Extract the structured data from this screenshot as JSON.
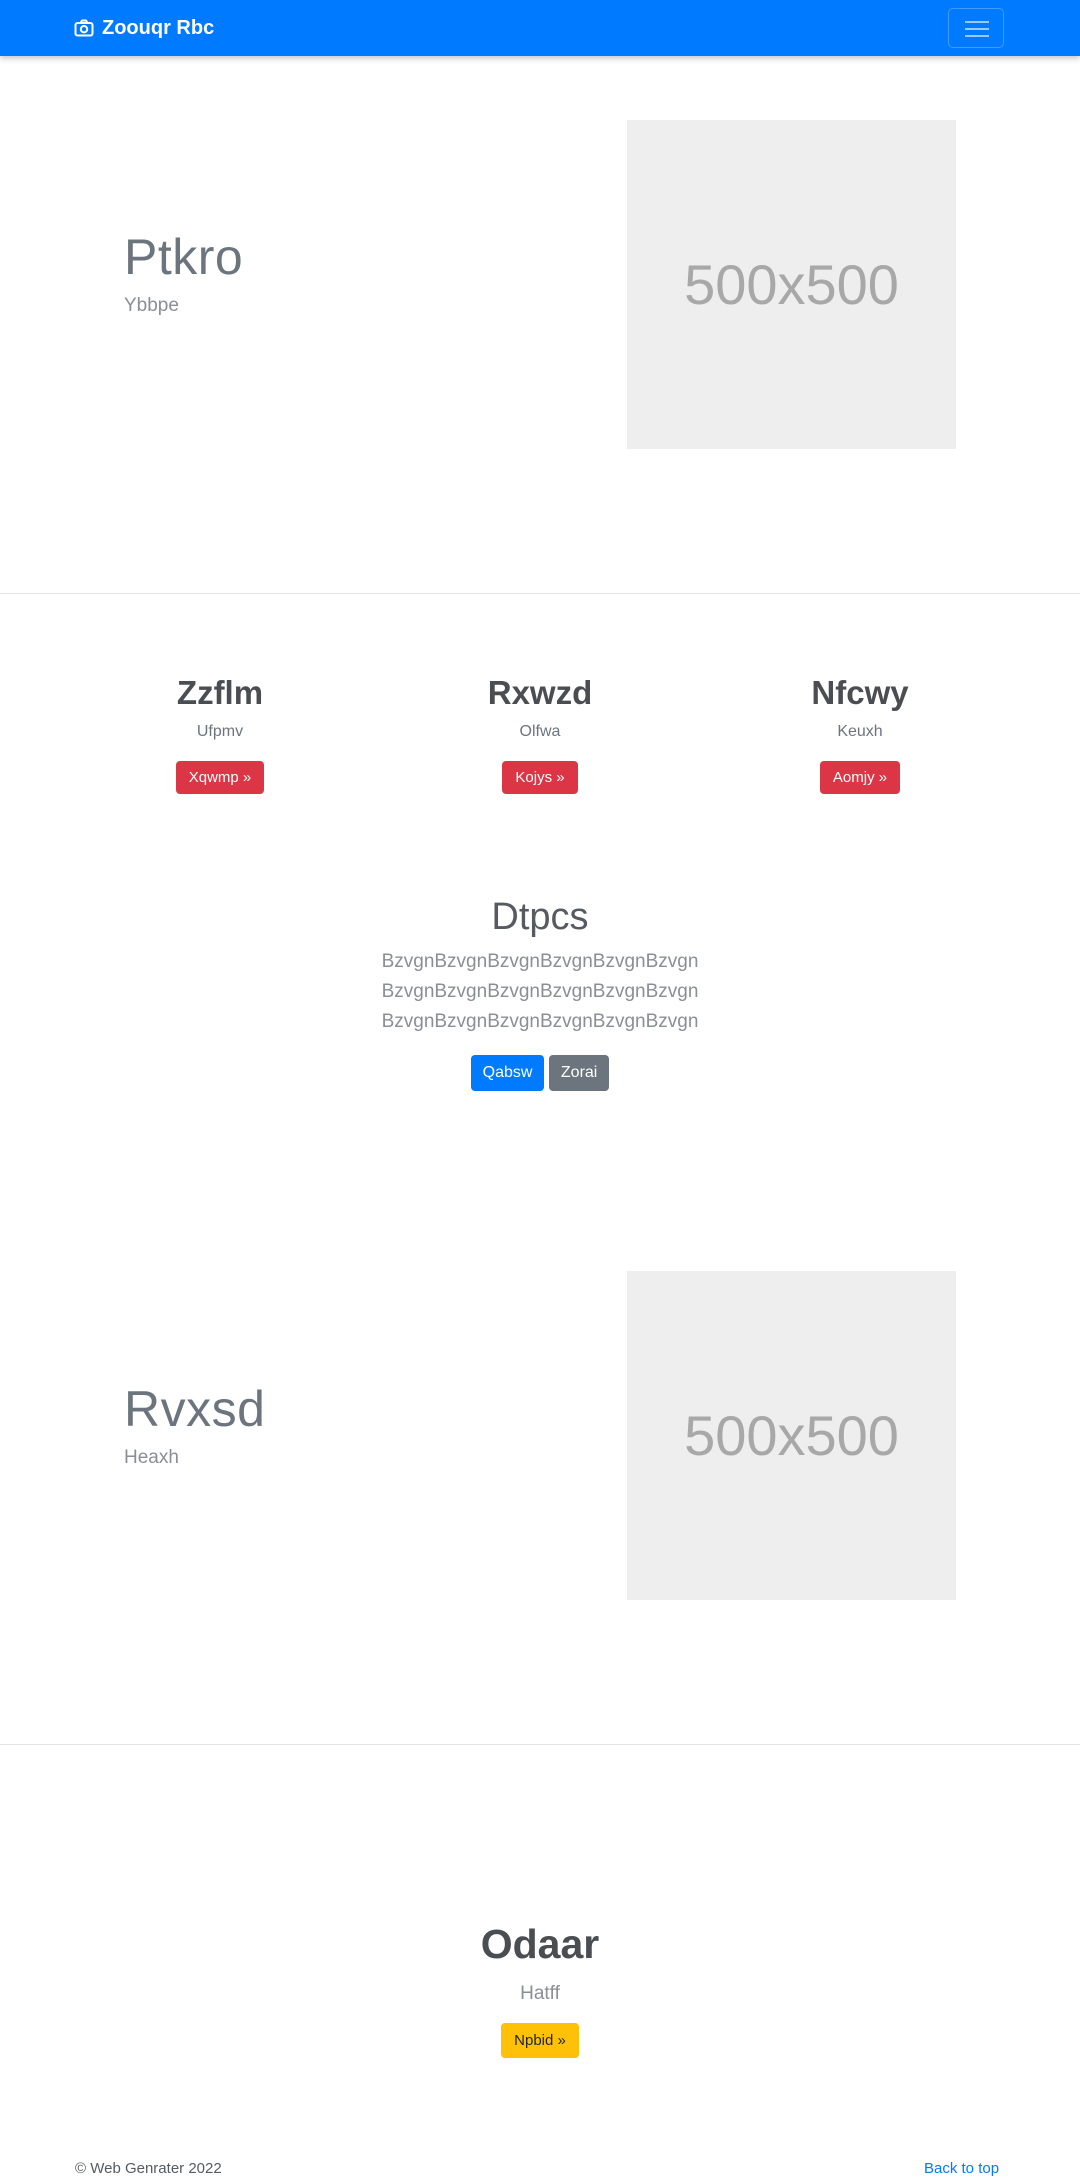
{
  "navbar": {
    "brand": "Zoouqr Rbc",
    "brand_icon": "camera-icon",
    "toggler_icon": "menu-icon"
  },
  "hero1": {
    "title": "Ptkro",
    "subtitle": "Ybbpe",
    "image_label": "500x500"
  },
  "features": [
    {
      "title": "Zzflm",
      "subtitle": "Ufpmv",
      "button": "Xqwmp »"
    },
    {
      "title": "Rxwzd",
      "subtitle": "Olfwa",
      "button": "Kojys »"
    },
    {
      "title": "Nfcwy",
      "subtitle": "Keuxh",
      "button": "Aomjy »"
    }
  ],
  "jumbotron": {
    "title": "Dtpcs",
    "lines": [
      "BzvgnBzvgnBzvgnBzvgnBzvgnBzvgn",
      "BzvgnBzvgnBzvgnBzvgnBzvgnBzvgn",
      "BzvgnBzvgnBzvgnBzvgnBzvgnBzvgn"
    ],
    "primary_button": "Qabsw",
    "secondary_button": "Zorai"
  },
  "hero2": {
    "title": "Rvxsd",
    "subtitle": "Heaxh",
    "image_label": "500x500"
  },
  "cta": {
    "title": "Odaar",
    "subtitle": "Hatff",
    "button": "Npbid »"
  },
  "footer": {
    "copyright": "© Web Genrater 2022",
    "back_to_top": "Back to top"
  },
  "colors": {
    "primary": "#007bff",
    "danger": "#dc3545",
    "secondary": "#6c757d",
    "warning": "#ffc107"
  }
}
